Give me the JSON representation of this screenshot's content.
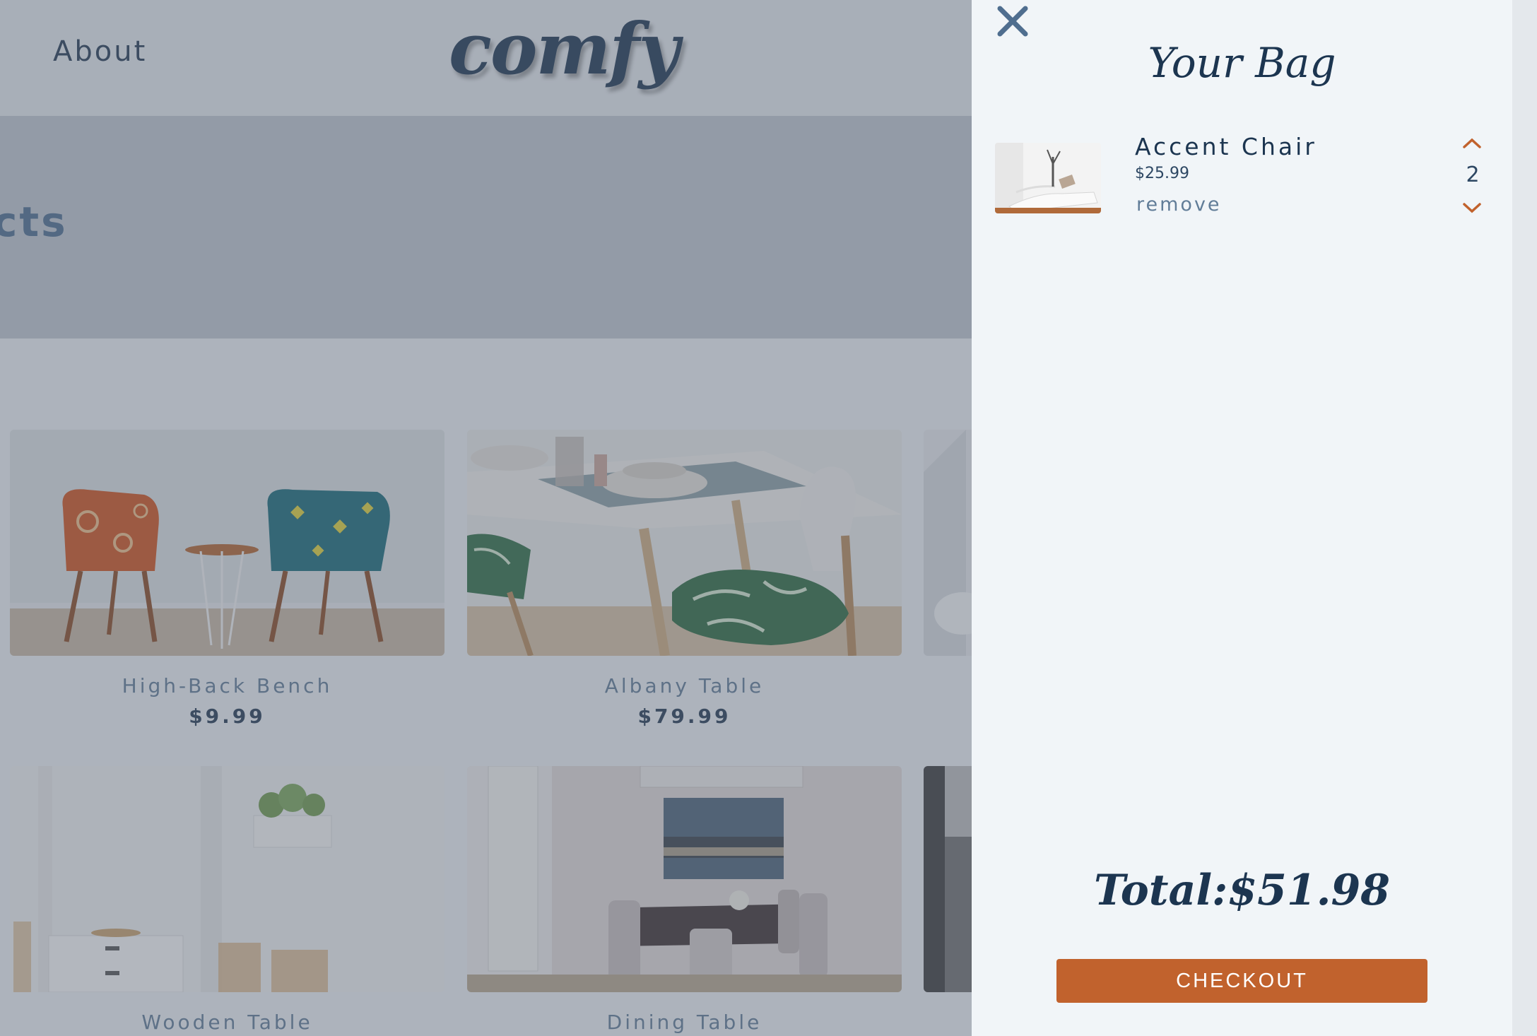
{
  "navbar": {
    "about_label": "About",
    "logo": "comfy"
  },
  "banner": {
    "title_fragment": "cts"
  },
  "products": [
    {
      "name": "High-Back Bench",
      "price": "$9.99"
    },
    {
      "name": "Albany Table",
      "price": "$79.99"
    },
    {
      "name": "Wooden Table",
      "price": ""
    },
    {
      "name": "Dining Table",
      "price": ""
    }
  ],
  "cart": {
    "title": "Your Bag",
    "items": [
      {
        "name": "Accent Chair",
        "price": "$25.99",
        "remove_label": "remove",
        "quantity": "2"
      }
    ],
    "total": "Total:$51.98",
    "checkout_label": "CHECKOUT"
  },
  "colors": {
    "accent": "#c1622d",
    "text_dark": "#1c3550",
    "text_muted": "#617d98",
    "drawer_bg": "#f1f5f8"
  }
}
